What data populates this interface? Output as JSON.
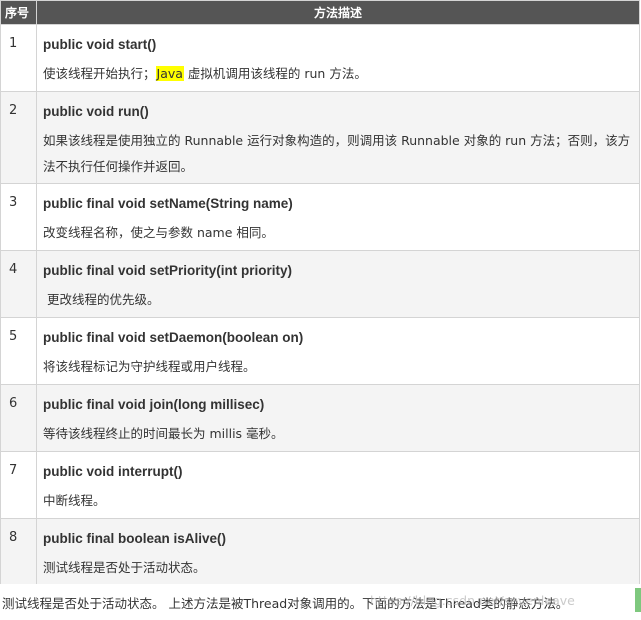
{
  "table": {
    "headers": {
      "index": "序号",
      "description": "方法描述"
    },
    "rows": [
      {
        "index": "1",
        "signature": "public void start()",
        "desc_before": "使该线程开始执行；",
        "desc_highlight": "Java",
        "desc_after": " 虚拟机调用该线程的 run 方法。"
      },
      {
        "index": "2",
        "signature": "public void run()",
        "desc": "如果该线程是使用独立的 Runnable 运行对象构造的，则调用该 Runnable 对象的 run 方法；否则，该方法不执行任何操作并返回。"
      },
      {
        "index": "3",
        "signature": "public final void setName(String name)",
        "desc": "改变线程名称，使之与参数 name 相同。"
      },
      {
        "index": "4",
        "signature": "public final void setPriority(int priority)",
        "desc": " 更改线程的优先级。"
      },
      {
        "index": "5",
        "signature": "public final void setDaemon(boolean on)",
        "desc": "将该线程标记为守护线程或用户线程。"
      },
      {
        "index": "6",
        "signature": "public final void join(long millisec)",
        "desc": "等待该线程终止的时间最长为 millis 毫秒。"
      },
      {
        "index": "7",
        "signature": "public void interrupt()",
        "desc": "中断线程。"
      },
      {
        "index": "8",
        "signature": "public final boolean isAlive()",
        "desc": "测试线程是否处于活动状态。"
      }
    ]
  },
  "footer": {
    "text": "测试线程是否处于活动状态。 上述方法是被Thread对象调用的。下面的方法是Thread类的静态方法。",
    "watermark": "https://blog.csdn.net/sevenleave"
  },
  "colors": {
    "header_bg": "#555555",
    "row_alt_bg": "#f4f4f4",
    "highlight": "#ffff00",
    "border": "#d4d4d4"
  }
}
